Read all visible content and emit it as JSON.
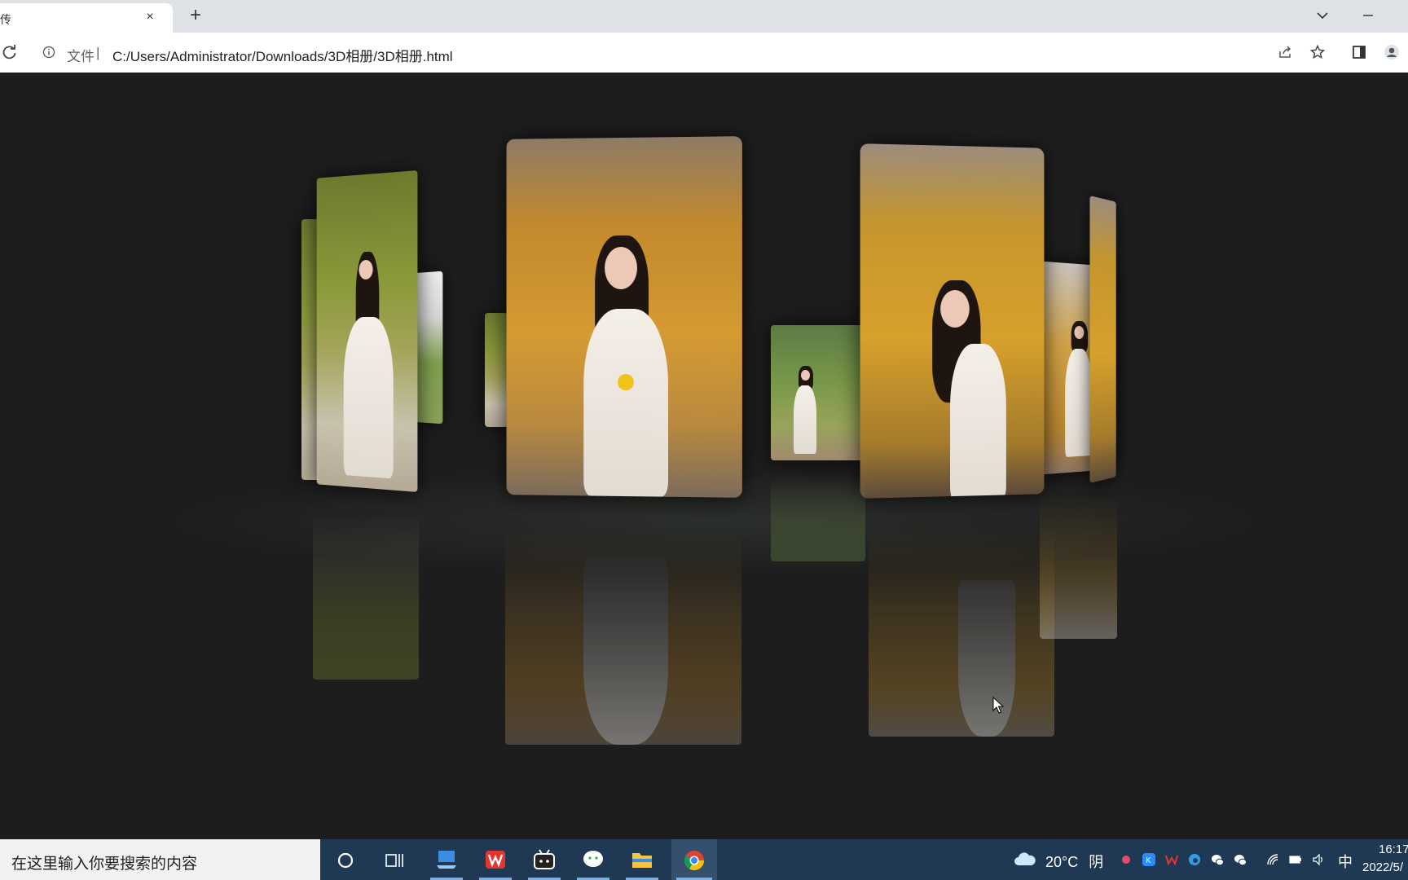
{
  "browser": {
    "tab_title": "传",
    "tab_close": "×",
    "new_tab": "+",
    "address": {
      "scheme_label": "文件",
      "separator": "|",
      "url": "C:/Users/Administrator/Downloads/3D相册/3D相册.html"
    },
    "toolbar_icons": [
      "reload-icon",
      "info-icon",
      "share-icon",
      "star-icon",
      "side-panel-icon",
      "profile-icon"
    ]
  },
  "gallery": {
    "photo_count": 8
  },
  "taskbar": {
    "search_placeholder": "在这里输入你要搜索的内容",
    "apps": [
      "cortana",
      "task-view",
      "remote-desktop",
      "wps",
      "bilibili",
      "wechat",
      "file-explorer",
      "chrome"
    ],
    "weather": {
      "temperature": "20°C",
      "condition": "阴"
    },
    "ime": "中",
    "time": "16:17",
    "date": "2022/5/"
  }
}
